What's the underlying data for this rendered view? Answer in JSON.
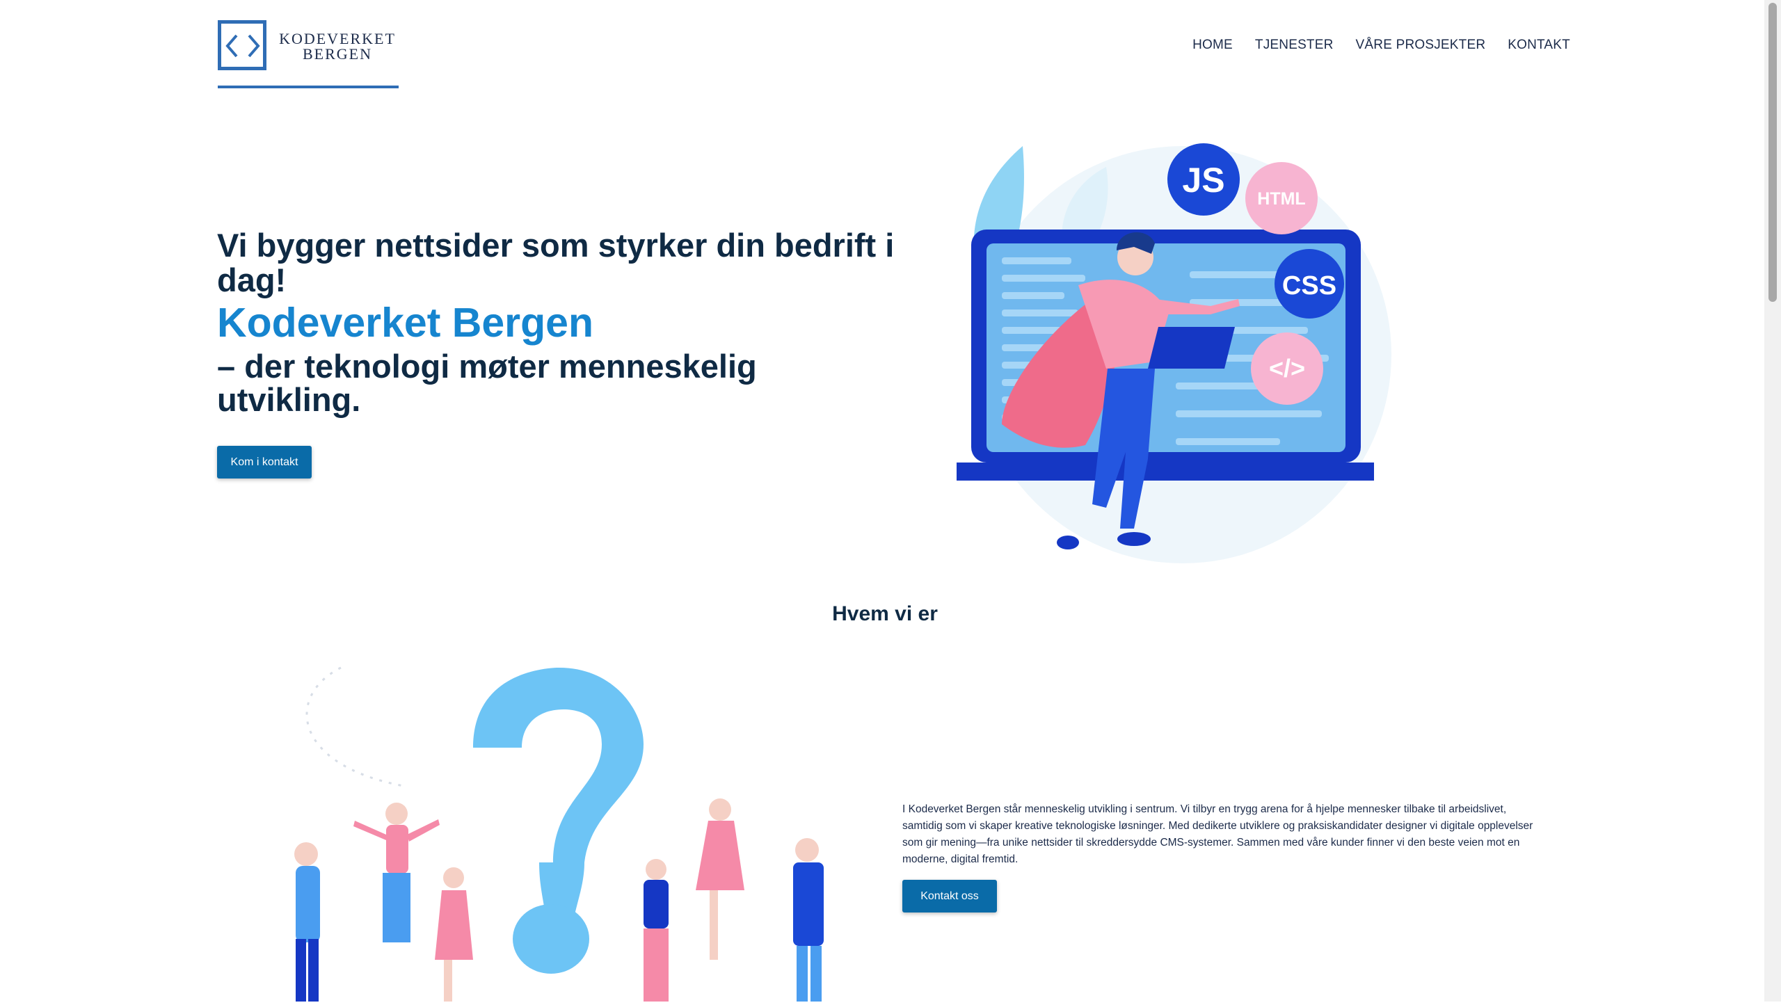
{
  "brand": {
    "logo_line1": "KODEVERKET",
    "logo_line2": "BERGEN",
    "color": "#2f6db5"
  },
  "nav": {
    "items": [
      {
        "label": "HOME"
      },
      {
        "label": "TJENESTER"
      },
      {
        "label": "VÅRE PROSJEKTER"
      },
      {
        "label": "KONTAKT"
      }
    ]
  },
  "hero": {
    "headline": "Vi bygger nettsider som styrker din bedrift i dag!",
    "brand_name": "Kodeverket Bergen",
    "subline": "– der teknologi møter menneskelig utvikling.",
    "cta_label": "Kom i kontakt",
    "illustration": {
      "badges": [
        "JS",
        "HTML",
        "CSS",
        "</>"
      ],
      "icon": "developer-superhero-illustration"
    }
  },
  "about": {
    "title": "Hvem vi er",
    "body": "I Kodeverket Bergen står menneskelig utvikling i sentrum. Vi tilbyr en trygg arena for å hjelpe mennesker tilbake til arbeidslivet, samtidig som vi skaper kreative teknologiske løsninger. Med dedikerte utviklere og praksiskandidater designer vi digitale opplevelser som gir mening—fra unike nettsider til skreddersydde CMS-systemer. Sammen med våre kunder finner vi den beste veien mot en moderne, digital fremtid.",
    "cta_label": "Kontakt oss",
    "illustration": {
      "icon": "question-mark-people-illustration"
    }
  },
  "colors": {
    "primary_button": "#0a6ba8",
    "heading": "#0f2a44",
    "brand_accent": "#1685cf"
  }
}
